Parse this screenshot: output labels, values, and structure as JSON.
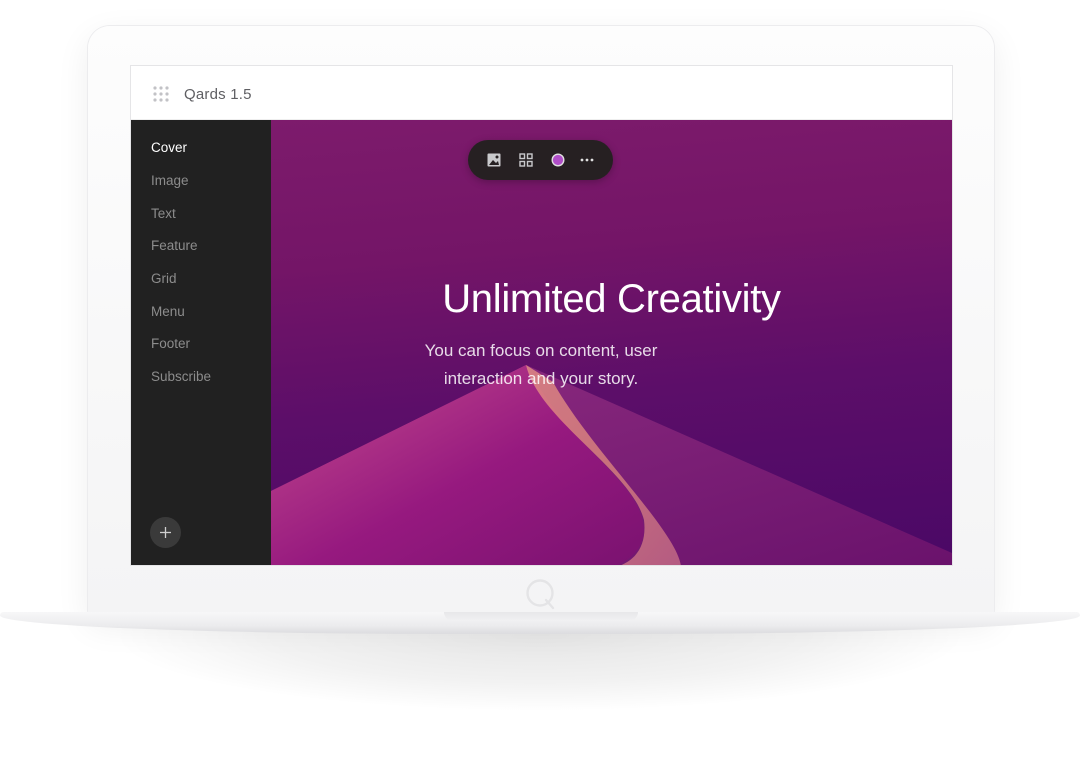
{
  "app": {
    "title": "Qards 1.5"
  },
  "sidebar": {
    "items": [
      {
        "label": "Cover",
        "active": true
      },
      {
        "label": "Image",
        "active": false
      },
      {
        "label": "Text",
        "active": false
      },
      {
        "label": "Feature",
        "active": false
      },
      {
        "label": "Grid",
        "active": false
      },
      {
        "label": "Menu",
        "active": false
      },
      {
        "label": "Footer",
        "active": false
      },
      {
        "label": "Subscribe",
        "active": false
      }
    ],
    "add_button_icon": "plus-icon"
  },
  "toolbar": {
    "buttons": [
      "image-icon",
      "grid-icon",
      "color-circle-icon",
      "more-dots-icon"
    ],
    "accent_color": "#b04ec8"
  },
  "hero": {
    "title": "Unlimited Creativity",
    "subtitle_line1": "You can focus on content, user",
    "subtitle_line2": "interaction and your story."
  },
  "colors": {
    "sidebar_bg": "#212121",
    "canvas_top": "#7d1b6c",
    "canvas_bottom": "#4a0866"
  }
}
